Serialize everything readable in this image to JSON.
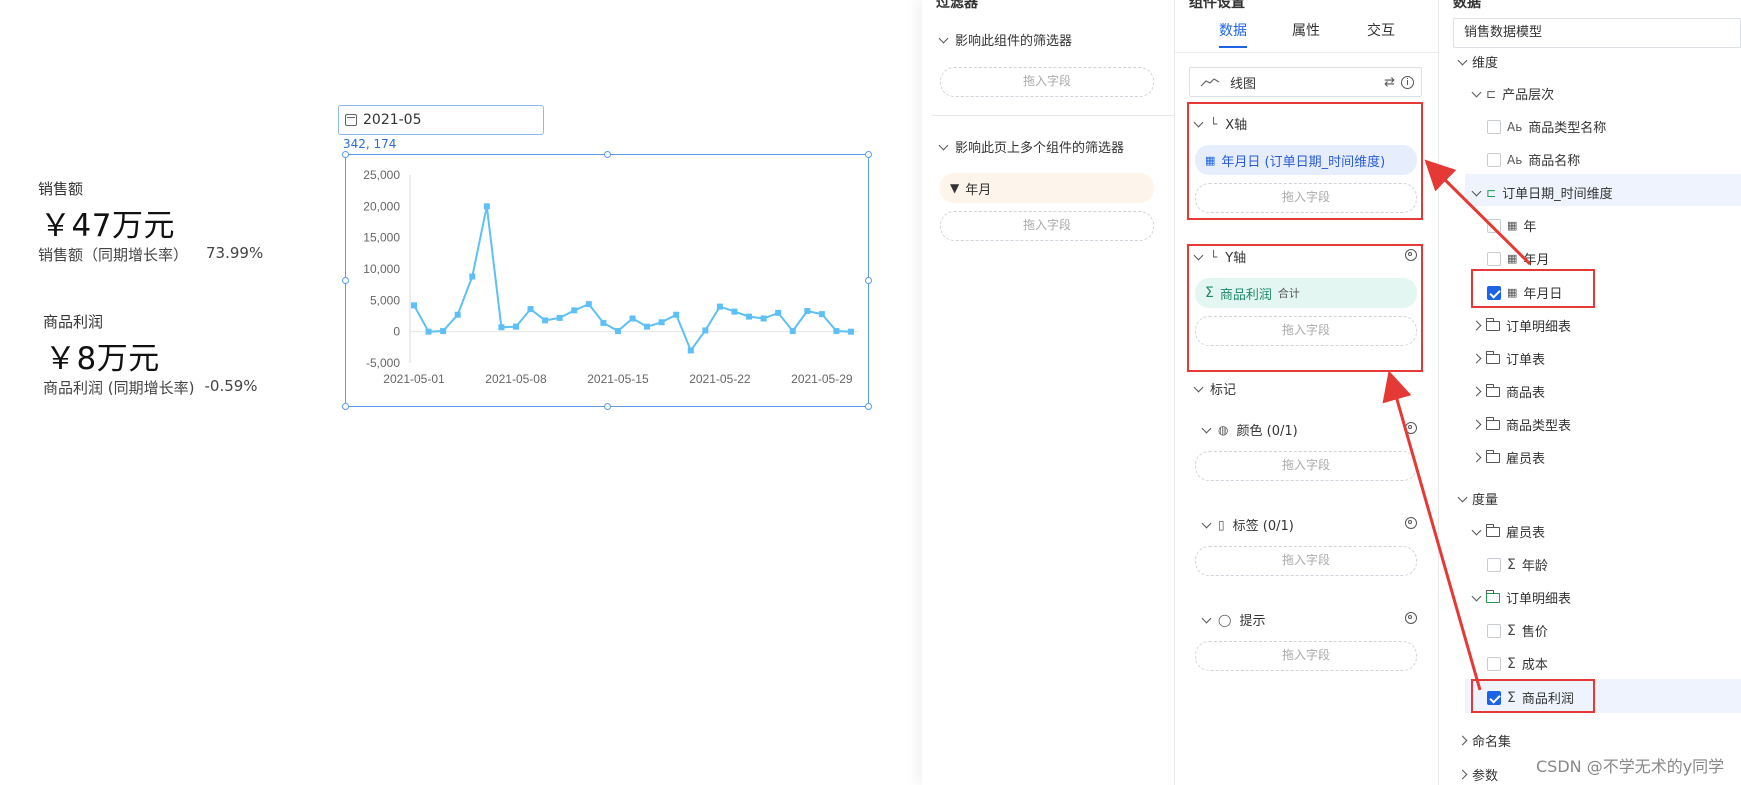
{
  "kpis": {
    "sales": {
      "label": "销售额",
      "value": "￥47万元",
      "sub_label": "销售额（同期增长率）",
      "sub_value": "73.99%"
    },
    "profit": {
      "label": "商品利润",
      "value": "￥8万元",
      "sub_label": "商品利润 (同期增长率)",
      "sub_value": "-0.59%"
    }
  },
  "date_picker": {
    "value": "2021-05"
  },
  "coord_readout": "342, 174",
  "chart_data": {
    "type": "line",
    "x": [
      "2021-05-01",
      "2021-05-02",
      "2021-05-03",
      "2021-05-04",
      "2021-05-05",
      "2021-05-06",
      "2021-05-07",
      "2021-05-08",
      "2021-05-09",
      "2021-05-10",
      "2021-05-11",
      "2021-05-12",
      "2021-05-13",
      "2021-05-14",
      "2021-05-15",
      "2021-05-16",
      "2021-05-17",
      "2021-05-18",
      "2021-05-19",
      "2021-05-20",
      "2021-05-21",
      "2021-05-22",
      "2021-05-23",
      "2021-05-24",
      "2021-05-25",
      "2021-05-26",
      "2021-05-27",
      "2021-05-28",
      "2021-05-29",
      "2021-05-30",
      "2021-05-31"
    ],
    "values": [
      4200,
      0,
      100,
      2700,
      8800,
      20000,
      700,
      800,
      3600,
      1800,
      2200,
      3400,
      4400,
      1400,
      100,
      2100,
      800,
      1500,
      2700,
      -3000,
      200,
      4000,
      3200,
      2400,
      2100,
      3000,
      100,
      3300,
      2800,
      100,
      0
    ],
    "x_tick_labels": [
      "2021-05-01",
      "2021-05-08",
      "2021-05-15",
      "2021-05-22",
      "2021-05-29"
    ],
    "x_tick_index": [
      0,
      7,
      14,
      21,
      28
    ],
    "y_tick_labels": [
      "25,000",
      "20,000",
      "15,000",
      "10,000",
      "5,000",
      "0",
      "-5,000"
    ],
    "y_ticks": [
      25000,
      20000,
      15000,
      10000,
      5000,
      0,
      -5000
    ],
    "ylim": [
      -5000,
      25000
    ],
    "line_color": "#5ec0f5"
  },
  "filter_panel": {
    "title": "过滤器",
    "section1": {
      "title": "影响此组件的筛选器",
      "drop": "拖入字段"
    },
    "section2": {
      "title": "影响此页上多个组件的筛选器",
      "chip": "年月",
      "drop": "拖入字段"
    }
  },
  "settings_panel": {
    "title": "组件设置",
    "tabs": [
      "数据",
      "属性",
      "交互"
    ],
    "chart_type": "线图",
    "x_axis": {
      "title": "X轴",
      "field": "年月日 (订单日期_时间维度)",
      "drop": "拖入字段"
    },
    "y_axis": {
      "title": "Y轴",
      "field": "商品利润",
      "agg": "合计",
      "drop": "拖入字段"
    },
    "marks": {
      "title": "标记",
      "color": {
        "title": "颜色 (0/1)",
        "drop": "拖入字段"
      },
      "label": {
        "title": "标签 (0/1)",
        "drop": "拖入字段"
      },
      "tooltip": {
        "title": "提示",
        "drop": "拖入字段"
      }
    }
  },
  "data_panel": {
    "title": "数据",
    "model_select": "销售数据模型",
    "dimension_title": "维度",
    "product_hierarchy": "产品层次",
    "product_type_name": "商品类型名称",
    "product_name": "商品名称",
    "order_date_dim": "订单日期_时间维度",
    "year": "年",
    "year_month": "年月",
    "year_month_day": "年月日",
    "folders": [
      "订单明细表",
      "订单表",
      "商品表",
      "商品类型表",
      "雇员表"
    ],
    "measure_title": "度量",
    "employee_table": "雇员表",
    "age": "年龄",
    "order_detail_table": "订单明细表",
    "price": "售价",
    "cost": "成本",
    "product_profit": "商品利润",
    "named_sets": "命名集",
    "params": "参数"
  },
  "watermark": "CSDN @不学无术的y同学"
}
